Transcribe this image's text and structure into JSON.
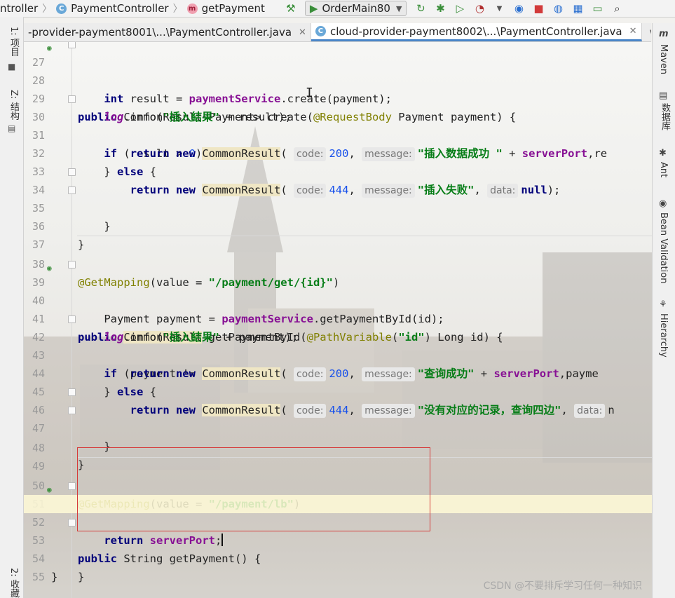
{
  "breadcrumb": {
    "items": [
      {
        "label": "ntroller",
        "icon": ""
      },
      {
        "label": "PaymentController",
        "icon": "class-icon"
      },
      {
        "label": "getPayment",
        "icon": "method-icon"
      }
    ]
  },
  "toolbar": {
    "run_config": "OrderMain80",
    "icons": [
      "hammer-icon",
      "rerun-icon",
      "bug-icon",
      "coverage-icon",
      "profile-icon",
      "dropdown-icon",
      "jrebel-icon",
      "stop-icon",
      "update-icon",
      "project-structure-icon",
      "window-icon",
      "search-icon"
    ]
  },
  "tabs": [
    {
      "label": "-provider-payment8001\\...\\PaymentController.java",
      "active": false
    },
    {
      "label": "cloud-provider-payment8002\\...\\PaymentController.java",
      "active": true
    }
  ],
  "left_panel": {
    "project_label": "1: 项目",
    "structure_label": "Z: 结构",
    "favorites_label": "2: 收藏"
  },
  "right_panel": {
    "maven_label": "Maven",
    "database_label": "数据库",
    "ant_label": "Ant",
    "bean_label": "Bean Validation",
    "hierarchy_label": "Hierarchy"
  },
  "editor": {
    "current_line": 52,
    "lines": [
      {
        "n": "27",
        "text": "public CommonResult<Payment> create(@RequestBody Payment payment) {"
      },
      {
        "n": "28",
        "text": "int result = paymentService.create(payment);"
      },
      {
        "n": "29",
        "text": "log.info(\"插入結果\" + result);"
      },
      {
        "n": "30",
        "text": "if (result > 0) {"
      },
      {
        "n": "31",
        "text": "return new CommonResult( code: 200, message: \"插入数据成功 \" + serverPort,re"
      },
      {
        "n": "32",
        "text": "} else {"
      },
      {
        "n": "33",
        "text": "return new CommonResult( code: 444, message: \"插入失败\", data: null);"
      },
      {
        "n": "34",
        "text": "}"
      },
      {
        "n": "35",
        "text": "}"
      },
      {
        "n": "36",
        "text": ""
      },
      {
        "n": "37",
        "text": ""
      },
      {
        "n": "38",
        "text": "@GetMapping(value = \"/payment/get/{id}\")"
      },
      {
        "n": "39",
        "text": "public CommonResult getPaymentById(@PathVariable(\"id\") Long id) {"
      },
      {
        "n": "40",
        "text": "Payment payment = paymentService.getPaymentById(id);"
      },
      {
        "n": "41",
        "text": "log.info(\"插入結果\" + payment);"
      },
      {
        "n": "42",
        "text": "if (payment != null) {"
      },
      {
        "n": "43",
        "text": "return new CommonResult( code: 200, message: \"查询成功\" + serverPort,payme"
      },
      {
        "n": "44",
        "text": "} else {"
      },
      {
        "n": "45",
        "text": "return new CommonResult( code: 444, message: \"没有对应的记录，查询四边\", data: n"
      },
      {
        "n": "46",
        "text": "}"
      },
      {
        "n": "47",
        "text": "}"
      },
      {
        "n": "48",
        "text": ""
      },
      {
        "n": "49",
        "text": ""
      },
      {
        "n": "50",
        "text": "@GetMapping(value = \"/payment/lb\")"
      },
      {
        "n": "51",
        "text": "public String getPayment() {"
      },
      {
        "n": "52",
        "text": "return serverPort;"
      },
      {
        "n": "53",
        "text": "}"
      },
      {
        "n": "54",
        "text": "}"
      },
      {
        "n": "55",
        "text": ""
      }
    ]
  },
  "watermark": "CSDN @不要排斥学习任何一种知识",
  "colors": {
    "keyword": "#00007a",
    "string": "#067d17",
    "field": "#871094",
    "annotation": "#808000",
    "number": "#1750eb",
    "highlight_box": "#d63a3a"
  }
}
